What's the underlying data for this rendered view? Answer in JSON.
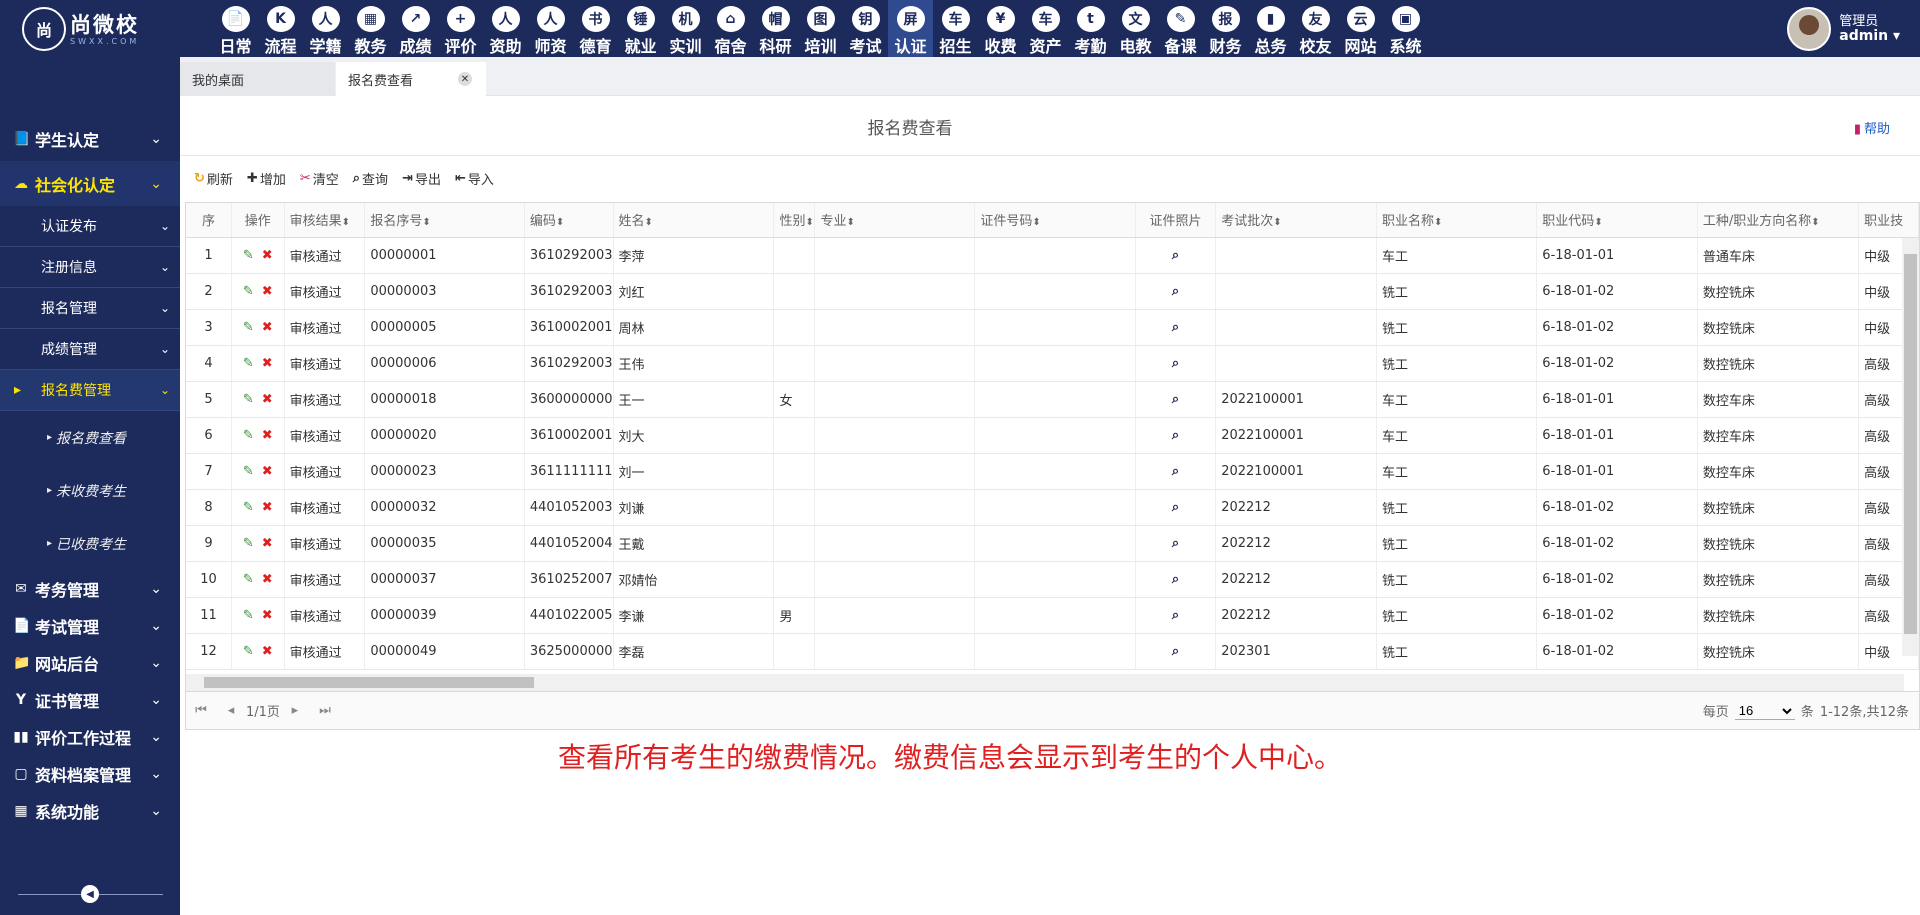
{
  "app": {
    "logo_text": "尚微校",
    "logo_sub": "SWXX.COM"
  },
  "nav": [
    {
      "label": "日常",
      "icon": "📄"
    },
    {
      "label": "流程",
      "icon": "K"
    },
    {
      "label": "学籍",
      "icon": "人"
    },
    {
      "label": "教务",
      "icon": "▦"
    },
    {
      "label": "成绩",
      "icon": "↗"
    },
    {
      "label": "评价",
      "icon": "+"
    },
    {
      "label": "资助",
      "icon": "人"
    },
    {
      "label": "师资",
      "icon": "人"
    },
    {
      "label": "德育",
      "icon": "书"
    },
    {
      "label": "就业",
      "icon": "锤"
    },
    {
      "label": "实训",
      "icon": "机"
    },
    {
      "label": "宿舍",
      "icon": "⌂"
    },
    {
      "label": "科研",
      "icon": "帽"
    },
    {
      "label": "培训",
      "icon": "图"
    },
    {
      "label": "考试",
      "icon": "钥"
    },
    {
      "label": "认证",
      "icon": "屏"
    },
    {
      "label": "招生",
      "icon": "车"
    },
    {
      "label": "收费",
      "icon": "¥"
    },
    {
      "label": "资产",
      "icon": "车"
    },
    {
      "label": "考勤",
      "icon": "t"
    },
    {
      "label": "电教",
      "icon": "文"
    },
    {
      "label": "备课",
      "icon": "✎"
    },
    {
      "label": "财务",
      "icon": "报"
    },
    {
      "label": "总务",
      "icon": "▮"
    },
    {
      "label": "校友",
      "icon": "友"
    },
    {
      "label": "网站",
      "icon": "云"
    },
    {
      "label": "系统",
      "icon": "▣"
    }
  ],
  "user": {
    "role": "管理员",
    "name": "admin"
  },
  "sidebar": {
    "groups_top": [
      {
        "label": "学生认定",
        "icon": "📘"
      },
      {
        "label": "社会化认定",
        "icon": "☁"
      }
    ],
    "subs": [
      {
        "label": "认证发布"
      },
      {
        "label": "注册信息"
      },
      {
        "label": "报名管理"
      },
      {
        "label": "成绩管理"
      },
      {
        "label": "报名费管理"
      }
    ],
    "leaves": [
      {
        "label": "报名费查看"
      },
      {
        "label": "未收费考生"
      },
      {
        "label": "已收费考生"
      }
    ],
    "groups_bottom": [
      {
        "label": "考务管理",
        "icon": "✉"
      },
      {
        "label": "考试管理",
        "icon": "📄"
      },
      {
        "label": "网站后台",
        "icon": "📁"
      },
      {
        "label": "证书管理",
        "icon": "Y"
      },
      {
        "label": "评价工作过程",
        "icon": "▮▮"
      },
      {
        "label": "资料档案管理",
        "icon": "▢"
      },
      {
        "label": "系统功能",
        "icon": "▦"
      }
    ]
  },
  "tabs": {
    "tab1": "我的桌面",
    "tab2": "报名费查看"
  },
  "page": {
    "title": "报名费查看",
    "help": "帮助"
  },
  "toolbar": {
    "refresh": "刷新",
    "add": "增加",
    "clear": "清空",
    "query": "查询",
    "export": "导出",
    "import": "导入"
  },
  "columns": [
    "序",
    "操作",
    "审核结果",
    "报名序号",
    "编码",
    "姓名",
    "性别",
    "专业",
    "证件号码",
    "证件照片",
    "考试批次",
    "职业名称",
    "职业代码",
    "工种/职业方向名称",
    "职业技"
  ],
  "rows": [
    {
      "no": "1",
      "status": "审核通过",
      "seq": "00000001",
      "code": "3610292003",
      "name": "李萍",
      "sex": "",
      "major": "",
      "id": "",
      "batch": "",
      "job": "车工",
      "jobcode": "6-18-01-01",
      "dir": "普通车床",
      "lvl": "中级"
    },
    {
      "no": "2",
      "status": "审核通过",
      "seq": "00000003",
      "code": "3610292003",
      "name": "刘红",
      "sex": "",
      "major": "",
      "id": "",
      "batch": "",
      "job": "铣工",
      "jobcode": "6-18-01-02",
      "dir": "数控铣床",
      "lvl": "中级"
    },
    {
      "no": "3",
      "status": "审核通过",
      "seq": "00000005",
      "code": "3610002001",
      "name": "周林",
      "sex": "",
      "major": "",
      "id": "",
      "batch": "",
      "job": "铣工",
      "jobcode": "6-18-01-02",
      "dir": "数控铣床",
      "lvl": "中级"
    },
    {
      "no": "4",
      "status": "审核通过",
      "seq": "00000006",
      "code": "3610292003",
      "name": "王伟",
      "sex": "",
      "major": "",
      "id": "",
      "batch": "",
      "job": "铣工",
      "jobcode": "6-18-01-02",
      "dir": "数控铣床",
      "lvl": "高级"
    },
    {
      "no": "5",
      "status": "审核通过",
      "seq": "00000018",
      "code": "3600000000",
      "name": "王一",
      "sex": "女",
      "major": "",
      "id": "",
      "batch": "2022100001",
      "job": "车工",
      "jobcode": "6-18-01-01",
      "dir": "数控车床",
      "lvl": "高级"
    },
    {
      "no": "6",
      "status": "审核通过",
      "seq": "00000020",
      "code": "3610002001",
      "name": "刘大",
      "sex": "",
      "major": "",
      "id": "",
      "batch": "2022100001",
      "job": "车工",
      "jobcode": "6-18-01-01",
      "dir": "数控车床",
      "lvl": "高级"
    },
    {
      "no": "7",
      "status": "审核通过",
      "seq": "00000023",
      "code": "3611111111",
      "name": "刘一",
      "sex": "",
      "major": "",
      "id": "",
      "batch": "2022100001",
      "job": "车工",
      "jobcode": "6-18-01-01",
      "dir": "数控车床",
      "lvl": "高级"
    },
    {
      "no": "8",
      "status": "审核通过",
      "seq": "00000032",
      "code": "4401052003",
      "name": "刘谦",
      "sex": "",
      "major": "",
      "id": "",
      "batch": "202212",
      "job": "铣工",
      "jobcode": "6-18-01-02",
      "dir": "数控铣床",
      "lvl": "高级"
    },
    {
      "no": "9",
      "status": "审核通过",
      "seq": "00000035",
      "code": "4401052004",
      "name": "王戴",
      "sex": "",
      "major": "",
      "id": "",
      "batch": "202212",
      "job": "铣工",
      "jobcode": "6-18-01-02",
      "dir": "数控铣床",
      "lvl": "高级"
    },
    {
      "no": "10",
      "status": "审核通过",
      "seq": "00000037",
      "code": "3610252007",
      "name": "邓婧怡",
      "sex": "",
      "major": "",
      "id": "",
      "batch": "202212",
      "job": "铣工",
      "jobcode": "6-18-01-02",
      "dir": "数控铣床",
      "lvl": "高级"
    },
    {
      "no": "11",
      "status": "审核通过",
      "seq": "00000039",
      "code": "4401022005",
      "name": "李谦",
      "sex": "男",
      "major": "",
      "id": "",
      "batch": "202212",
      "job": "铣工",
      "jobcode": "6-18-01-02",
      "dir": "数控铣床",
      "lvl": "高级"
    },
    {
      "no": "12",
      "status": "审核通过",
      "seq": "00000049",
      "code": "3625000000",
      "name": "李磊",
      "sex": "",
      "major": "",
      "id": "",
      "batch": "202301",
      "job": "铣工",
      "jobcode": "6-18-01-02",
      "dir": "数控铣床",
      "lvl": "中级"
    }
  ],
  "pager": {
    "pages": "1/1页",
    "per_page_label": "每页",
    "per_page": "16",
    "unit": "条",
    "summary": "1-12条,共12条"
  },
  "note": "查看所有考生的缴费情况。缴费信息会显示到考生的个人中心。",
  "colors": {
    "nav_bg": "#1d2b5c",
    "active_yellow": "#ffe400",
    "note_red": "#e02020"
  }
}
